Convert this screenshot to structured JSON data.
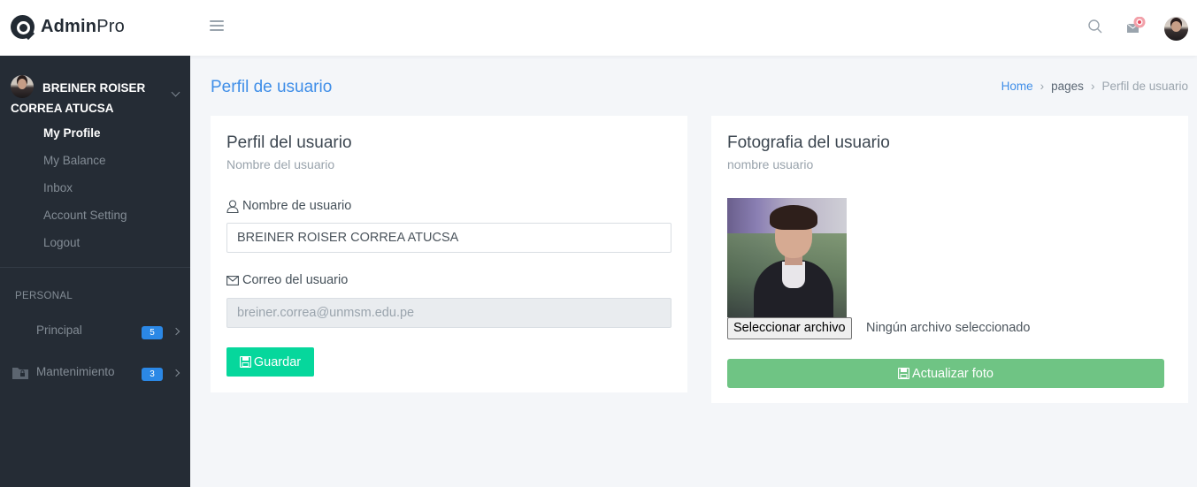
{
  "header": {
    "logo_bold": "Admin",
    "logo_light": "Pro"
  },
  "sidebar": {
    "user_name": "BREINER ROISER CORREA ATUCSA",
    "submenu": [
      "My Profile",
      "My Balance",
      "Inbox",
      "Account Setting",
      "Logout"
    ],
    "section_label": "PERSONAL",
    "nav": [
      {
        "label": "Principal",
        "badge": "5",
        "icon": "none"
      },
      {
        "label": "Mantenimiento",
        "badge": "3",
        "icon": "folder-lock-icon"
      }
    ]
  },
  "page": {
    "title": "Perfil de usuario",
    "breadcrumb": [
      "Home",
      "pages",
      "Perfil de usuario"
    ]
  },
  "profile_card": {
    "title": "Perfil del usuario",
    "subtitle": "Nombre del usuario",
    "name_label": "Nombre de usuario",
    "name_value": "BREINER ROISER CORREA ATUCSA",
    "email_label": "Correo del usuario",
    "email_value": "breiner.correa@unmsm.edu.pe",
    "save_label": "Guardar"
  },
  "photo_card": {
    "title": "Fotografia del usuario",
    "subtitle": "nombre usuario",
    "file_button": "Seleccionar archivo",
    "file_status": "Ningún archivo seleccionado",
    "update_label": "Actualizar foto"
  },
  "colors": {
    "accent": "#3f8ee8",
    "sidebar_bg": "#252c35",
    "save_button": "#06d79c",
    "update_button": "#6fc484",
    "badge": "#2b88e6"
  }
}
